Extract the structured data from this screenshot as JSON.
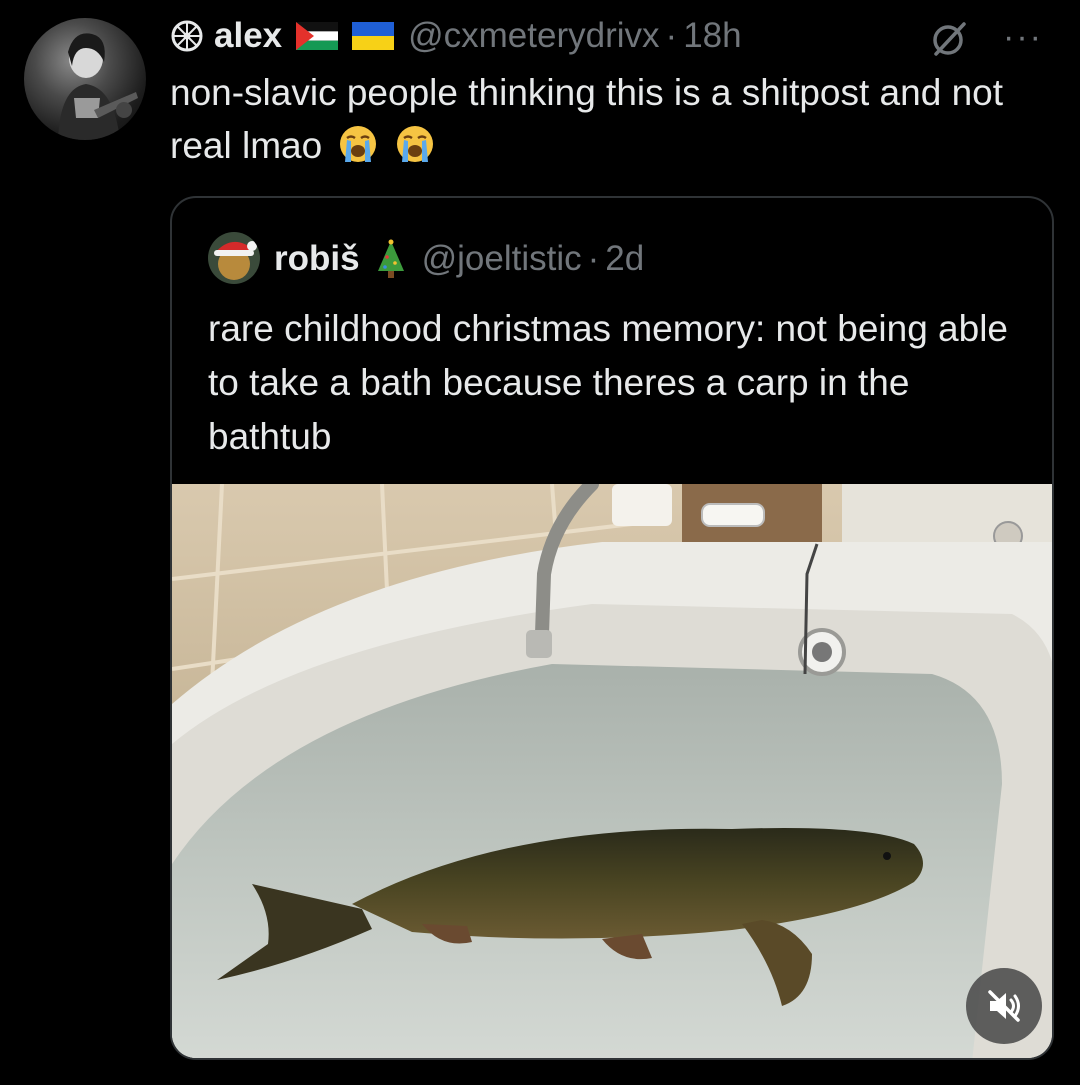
{
  "author": {
    "name": "alex",
    "handle": "@cxmeterydrivx",
    "separator": "·",
    "time": "18h",
    "flags": [
      "palestine-flag",
      "ukraine-flag"
    ]
  },
  "tweet": {
    "text": "non-slavic people thinking this is a shitpost and not real lmao",
    "emoji": [
      "loudly-crying-face",
      "loudly-crying-face"
    ]
  },
  "quoted": {
    "name": "robiš",
    "handle": "@joeltistic",
    "separator": "·",
    "time": "2d",
    "text": "rare childhood christmas memory: not being able to take a bath because theres a carp in the bathtub"
  },
  "icons": {
    "grok": "grok-icon",
    "more": "more-icon",
    "mute": "muted-speaker-icon"
  },
  "colors": {
    "background": "#000000",
    "text": "#e7e9ea",
    "muted": "#71767b",
    "border": "#2f3336"
  }
}
